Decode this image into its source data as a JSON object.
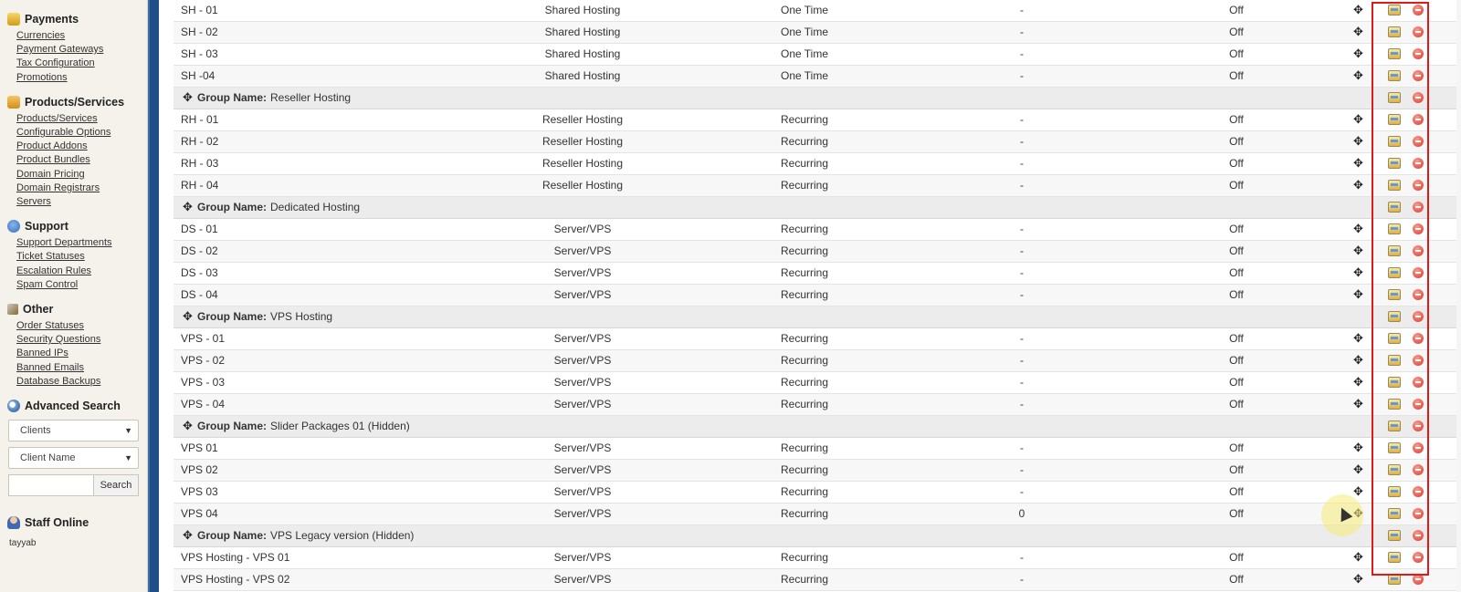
{
  "sidebar": {
    "sections": [
      {
        "title": "Payments",
        "icon": "payments-icon",
        "links": [
          "Currencies",
          "Payment Gateways",
          "Tax Configuration",
          "Promotions"
        ]
      },
      {
        "title": "Products/Services",
        "icon": "products-icon",
        "links": [
          "Products/Services",
          "Configurable Options",
          "Product Addons",
          "Product Bundles",
          "Domain Pricing",
          "Domain Registrars",
          "Servers"
        ]
      },
      {
        "title": "Support",
        "icon": "support-icon",
        "links": [
          "Support Departments",
          "Ticket Statuses",
          "Escalation Rules",
          "Spam Control"
        ]
      },
      {
        "title": "Other",
        "icon": "wrench-icon",
        "links": [
          "Order Statuses",
          "Security Questions",
          "Banned IPs",
          "Banned Emails",
          "Database Backups"
        ]
      }
    ],
    "advanced_search": {
      "title": "Advanced Search",
      "select1": "Clients",
      "select2": "Client Name",
      "input_value": "",
      "button": "Search"
    },
    "staff_online": {
      "title": "Staff Online",
      "name": "tayyab"
    }
  },
  "table": {
    "group_prefix": "Group Name:",
    "rows": [
      {
        "kind": "product",
        "name": "SH - 01",
        "type": "Shared Hosting",
        "pay": "One Time",
        "stock": "-",
        "hidden": "Off"
      },
      {
        "kind": "product",
        "name": "SH - 02",
        "type": "Shared Hosting",
        "pay": "One Time",
        "stock": "-",
        "hidden": "Off"
      },
      {
        "kind": "product",
        "name": "SH - 03",
        "type": "Shared Hosting",
        "pay": "One Time",
        "stock": "-",
        "hidden": "Off"
      },
      {
        "kind": "product",
        "name": "SH -04",
        "type": "Shared Hosting",
        "pay": "One Time",
        "stock": "-",
        "hidden": "Off"
      },
      {
        "kind": "group",
        "name": "Reseller Hosting"
      },
      {
        "kind": "product",
        "name": "RH - 01",
        "type": "Reseller Hosting",
        "pay": "Recurring",
        "stock": "-",
        "hidden": "Off"
      },
      {
        "kind": "product",
        "name": "RH - 02",
        "type": "Reseller Hosting",
        "pay": "Recurring",
        "stock": "-",
        "hidden": "Off"
      },
      {
        "kind": "product",
        "name": "RH - 03",
        "type": "Reseller Hosting",
        "pay": "Recurring",
        "stock": "-",
        "hidden": "Off"
      },
      {
        "kind": "product",
        "name": "RH - 04",
        "type": "Reseller Hosting",
        "pay": "Recurring",
        "stock": "-",
        "hidden": "Off"
      },
      {
        "kind": "group",
        "name": "Dedicated Hosting"
      },
      {
        "kind": "product",
        "name": "DS - 01",
        "type": "Server/VPS",
        "pay": "Recurring",
        "stock": "-",
        "hidden": "Off"
      },
      {
        "kind": "product",
        "name": "DS - 02",
        "type": "Server/VPS",
        "pay": "Recurring",
        "stock": "-",
        "hidden": "Off"
      },
      {
        "kind": "product",
        "name": "DS - 03",
        "type": "Server/VPS",
        "pay": "Recurring",
        "stock": "-",
        "hidden": "Off"
      },
      {
        "kind": "product",
        "name": "DS - 04",
        "type": "Server/VPS",
        "pay": "Recurring",
        "stock": "-",
        "hidden": "Off"
      },
      {
        "kind": "group",
        "name": "VPS Hosting"
      },
      {
        "kind": "product",
        "name": "VPS - 01",
        "type": "Server/VPS",
        "pay": "Recurring",
        "stock": "-",
        "hidden": "Off"
      },
      {
        "kind": "product",
        "name": "VPS - 02",
        "type": "Server/VPS",
        "pay": "Recurring",
        "stock": "-",
        "hidden": "Off"
      },
      {
        "kind": "product",
        "name": "VPS - 03",
        "type": "Server/VPS",
        "pay": "Recurring",
        "stock": "-",
        "hidden": "Off"
      },
      {
        "kind": "product",
        "name": "VPS - 04",
        "type": "Server/VPS",
        "pay": "Recurring",
        "stock": "-",
        "hidden": "Off"
      },
      {
        "kind": "group",
        "name": "Slider Packages 01 (Hidden)"
      },
      {
        "kind": "product",
        "name": "VPS 01",
        "type": "Server/VPS",
        "pay": "Recurring",
        "stock": "-",
        "hidden": "Off"
      },
      {
        "kind": "product",
        "name": "VPS 02",
        "type": "Server/VPS",
        "pay": "Recurring",
        "stock": "-",
        "hidden": "Off"
      },
      {
        "kind": "product",
        "name": "VPS 03",
        "type": "Server/VPS",
        "pay": "Recurring",
        "stock": "-",
        "hidden": "Off"
      },
      {
        "kind": "product",
        "name": "VPS 04",
        "type": "Server/VPS",
        "pay": "Recurring",
        "stock": "0",
        "hidden": "Off"
      },
      {
        "kind": "group",
        "name": "VPS Legacy version (Hidden)"
      },
      {
        "kind": "product",
        "name": "VPS Hosting - VPS 01",
        "type": "Server/VPS",
        "pay": "Recurring",
        "stock": "-",
        "hidden": "Off"
      },
      {
        "kind": "product",
        "name": "VPS Hosting - VPS 02",
        "type": "Server/VPS",
        "pay": "Recurring",
        "stock": "-",
        "hidden": "Off"
      }
    ]
  },
  "colors": {
    "sidebar_bg": "#f4f2ea",
    "divider_bar": "#1f4f86",
    "highlight": "#e01919"
  }
}
